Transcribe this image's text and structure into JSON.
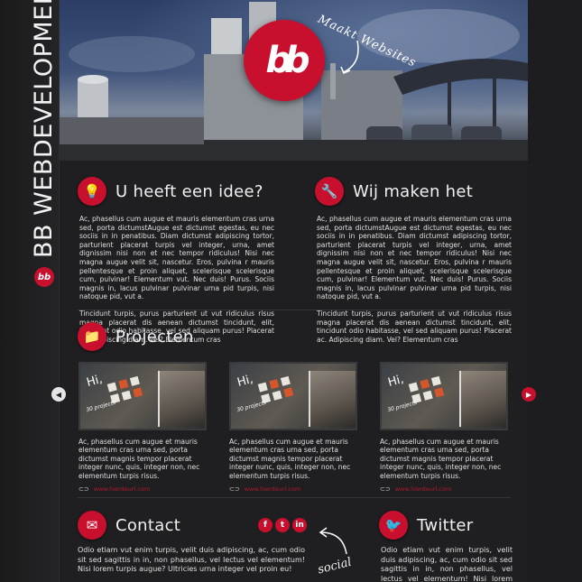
{
  "brand": {
    "name": "BB WEBDEVELOPMENT",
    "logo_text": "bb"
  },
  "hero": {
    "logo_text": "bb",
    "tagline": "Maakt Websites"
  },
  "sections": {
    "idee": {
      "title": "U heeft een idee?",
      "icon": "lightbulb-icon",
      "paragraph1": "Ac, phasellus cum augue et mauris elementum cras urna sed, porta dictumstAugue est dictumst egestas, eu nec sociis in in penatibus. Diam dictumst adipiscing tortor, parturient placerat turpis vel integer, urna, amet dignissim nisi non et nec tempor ridiculus! Nisi nec magna augue velit sit, nascetur. Eros, pulvina r mauris pellentesque et proin aliquet, scelerisque scelerisque cum, pulvinar! Elementum vut. Nec duis! Purus. Sociis magnis in, lacus pulvinar pulvinar urna pid turpis, nisi natoque pid, vut a.",
      "paragraph2": "Tincidunt turpis, purus parturient ut vut ridiculus risus magna placerat dis aenean dictumst tincidunt, elit, tincidunt odio habitasse, vel sed aliquam purus! Placerat ac. Adipiscing diam. Vel? Elementum cras"
    },
    "maken": {
      "title": "Wij maken het",
      "icon": "wrench-icon",
      "paragraph1": "Ac, phasellus cum augue et mauris elementum cras urna sed, porta dictumstAugue est dictumst egestas, eu nec sociis in in penatibus. Diam dictumst adipiscing tortor, parturient placerat turpis vel integer, urna, amet dignissim nisi non et nec tempor ridiculus! Nisi nec magna augue velit sit, nascetur. Eros, pulvina r mauris pellentesque et proin aliquet, scelerisque scelerisque cum, pulvinar! Elementum vut. Nec duis! Purus. Sociis magnis in, lacus pulvinar pulvinar urna pid turpis, nisi natoque pid, vut a.",
      "paragraph2": "Tincidunt turpis, purus parturient ut vut ridiculus risus magna placerat dis aenean dictumst tincidunt, elit, tincidunt odio habitasse, vel sed aliquam purus! Placerat ac. Adipiscing diam. Vel? Elementum cras"
    },
    "projecten": {
      "title": "Projecten",
      "icon": "folder-icon",
      "items": [
        {
          "thumb_hi": "Hi,",
          "thumb_caption": "30 projects",
          "description": "Ac, phasellus cum augue et mauris elementum cras urna sed, porta dictumst magnis tempor placerat integer nunc, quis, integer non, nec elementum turpis risus.",
          "link": "www.hierdeurl.com"
        },
        {
          "thumb_hi": "Hi,",
          "thumb_caption": "30 projects",
          "description": "Ac, phasellus cum augue et mauris elementum cras urna sed, porta dictumst magnis tempor placerat integer nunc, quis, integer non, nec elementum turpis risus.",
          "link": "www.hierdeurl.com"
        },
        {
          "thumb_hi": "Hi,",
          "thumb_caption": "30 projects",
          "description": "Ac, phasellus cum augue et mauris elementum cras urna sed, porta dictumst magnis tempor placerat integer nunc, quis, integer non, nec elementum turpis risus.",
          "link": "www.hierdeurl.com"
        }
      ],
      "prev_icon": "arrow-left-icon",
      "next_icon": "arrow-right-icon"
    },
    "contact": {
      "title": "Contact",
      "icon": "envelope-icon",
      "text": "Odio etiam vut enim turpis, velit duis adipiscing, ac, cum odio sit sed sagittis in in, non phasellus, vel lectus vel elementum! Nisi lorem turpis augue? Ultricies urna integer vel proin eu!"
    },
    "social": {
      "buttons": [
        "f",
        "t",
        "in"
      ],
      "label": "social"
    },
    "twitter": {
      "title": "Twitter",
      "icon": "twitter-bird-icon",
      "text": "Odio etiam vut enim turpis, velit duis adipiscing, ac, cum odio sit sed sagittis in in, non phasellus, vel lectus vel elementum! Nisi lorem turpis augue? Ultricies"
    }
  },
  "colors": {
    "accent": "#c8102e",
    "background": "#1f1f21",
    "text": "#e0e0e0"
  }
}
